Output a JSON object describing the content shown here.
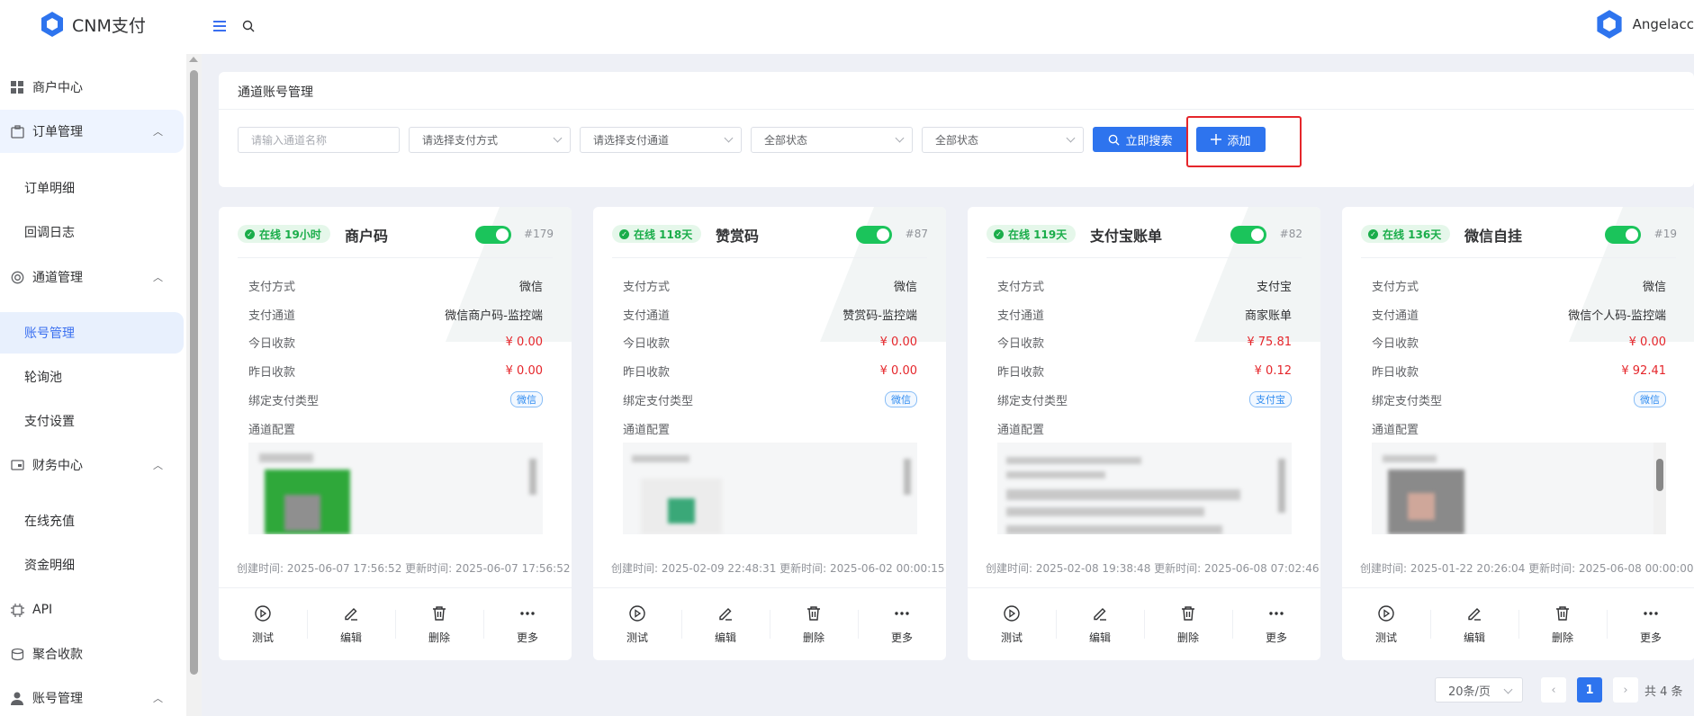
{
  "app": {
    "brand": "CNM支付",
    "user_name": "Angelacc"
  },
  "sidebar": {
    "items": [
      {
        "label": "商户中心",
        "icon": "grid-icon"
      },
      {
        "label": "订单管理",
        "icon": "clipboard-icon",
        "expanded": true,
        "children": [
          "订单明细",
          "回调日志"
        ]
      },
      {
        "label": "通道管理",
        "icon": "channel-icon",
        "expanded": true,
        "children": [
          "账号管理",
          "轮询池",
          "支付设置"
        ]
      },
      {
        "label": "财务中心",
        "icon": "wallet-icon",
        "expanded": true,
        "children": [
          "在线充值",
          "资金明细"
        ]
      },
      {
        "label": "API",
        "icon": "chip-icon"
      },
      {
        "label": "聚合收款",
        "icon": "collect-icon"
      },
      {
        "label": "账号管理",
        "icon": "user-icon",
        "expanded": true
      }
    ],
    "active_sub": "账号管理"
  },
  "panel": {
    "title": "通道账号管理",
    "filters": {
      "name_placeholder": "请输入通道名称",
      "pay_method": "请选择支付方式",
      "pay_channel": "请选择支付通道",
      "status1": "全部状态",
      "status2": "全部状态"
    },
    "search_label": "立即搜索",
    "add_label": "添加"
  },
  "labels": {
    "pay_method": "支付方式",
    "pay_channel": "支付通道",
    "today": "今日收款",
    "yesterday": "昨日收款",
    "bind_type": "绑定支付类型",
    "config": "通道配置",
    "created": "创建时间:",
    "updated": "更新时间:",
    "test": "测试",
    "edit": "编辑",
    "delete": "删除",
    "more": "更多"
  },
  "cards": [
    {
      "status": "在线 19小时",
      "name": "商户码",
      "id": "#179",
      "enabled": true,
      "method": "微信",
      "channel": "微信商户码-监控端",
      "today": "¥ 0.00",
      "yesterday": "¥ 0.00",
      "bind": "微信",
      "created": "2025-06-07 17:56:52",
      "updated": "2025-06-07 17:56:52"
    },
    {
      "status": "在线 118天",
      "name": "赞赏码",
      "id": "#87",
      "enabled": true,
      "method": "微信",
      "channel": "赞赏码-监控端",
      "today": "¥ 0.00",
      "yesterday": "¥ 0.00",
      "bind": "微信",
      "created": "2025-02-09 22:48:31",
      "updated": "2025-06-02 00:00:15"
    },
    {
      "status": "在线 119天",
      "name": "支付宝账单",
      "id": "#82",
      "enabled": true,
      "method": "支付宝",
      "channel": "商家账单",
      "today": "¥ 75.81",
      "yesterday": "¥ 0.12",
      "bind": "支付宝",
      "created": "2025-02-08 19:38:48",
      "updated": "2025-06-08 07:02:46"
    },
    {
      "status": "在线 136天",
      "name": "微信自挂",
      "id": "#19",
      "enabled": true,
      "method": "微信",
      "channel": "微信个人码-监控端",
      "today": "¥ 0.00",
      "yesterday": "¥ 92.41",
      "bind": "微信",
      "created": "2025-01-22 20:26:04",
      "updated": "2025-06-08 00:00:00"
    }
  ],
  "pagination": {
    "page_size": "20条/页",
    "current": "1",
    "total": "共 4 条"
  },
  "colors": {
    "primary": "#2e74ee",
    "success": "#1bc45b",
    "danger": "#e5262b",
    "highlight_box": "#e5262b"
  }
}
